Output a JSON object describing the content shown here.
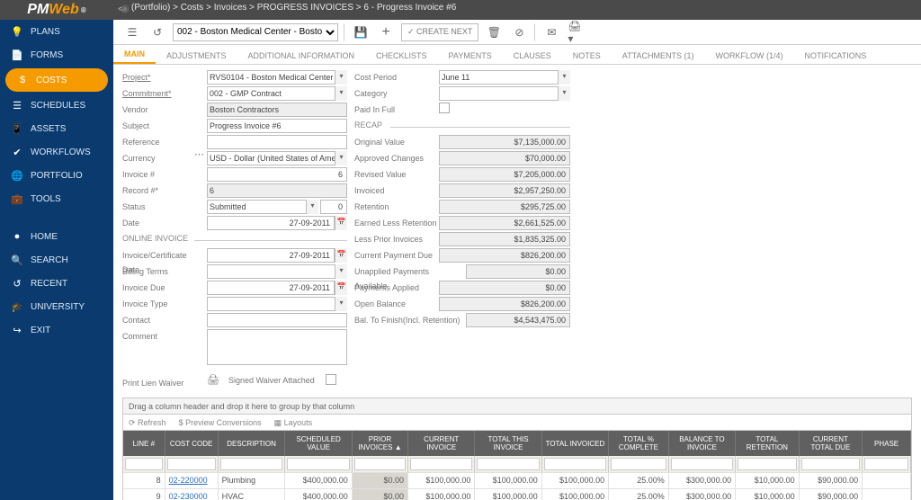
{
  "breadcrumb": "(Portfolio) > Costs > Invoices > PROGRESS INVOICES > 6 - Progress Invoice #6",
  "toolbar": {
    "project_selector": "002 - Boston Medical Center - Bosto",
    "create_next": "✓ CREATE NEXT"
  },
  "tabs": [
    "MAIN",
    "ADJUSTMENTS",
    "ADDITIONAL INFORMATION",
    "CHECKLISTS",
    "PAYMENTS",
    "CLAUSES",
    "NOTES",
    "ATTACHMENTS (1)",
    "WORKFLOW (1/4)",
    "NOTIFICATIONS"
  ],
  "leftnav": [
    {
      "ico": "💡",
      "lbl": "PLANS"
    },
    {
      "ico": "📄",
      "lbl": "FORMS"
    },
    {
      "ico": "$",
      "lbl": "COSTS",
      "active": true
    },
    {
      "ico": "☰",
      "lbl": "SCHEDULES"
    },
    {
      "ico": "📱",
      "lbl": "ASSETS"
    },
    {
      "ico": "✔",
      "lbl": "WORKFLOWS"
    },
    {
      "ico": "🌐",
      "lbl": "PORTFOLIO"
    },
    {
      "ico": "💼",
      "lbl": "TOOLS"
    },
    {
      "ico": "●",
      "lbl": "HOME"
    },
    {
      "ico": "🔍",
      "lbl": "SEARCH"
    },
    {
      "ico": "↺",
      "lbl": "RECENT"
    },
    {
      "ico": "🎓",
      "lbl": "UNIVERSITY"
    },
    {
      "ico": "↪",
      "lbl": "EXIT"
    }
  ],
  "labels": {
    "project": "Project*",
    "commitment": "Commitment*",
    "vendor": "Vendor",
    "subject": "Subject",
    "reference": "Reference",
    "currency": "Currency",
    "invoice_no": "Invoice #",
    "record_no": "Record #*",
    "status": "Status",
    "date": "Date",
    "online_invoice": "ONLINE INVOICE",
    "inv_cert_date": "Invoice/Certificate Date",
    "billing_terms": "Billing Terms",
    "invoice_due": "Invoice Due",
    "invoice_type": "Invoice Type",
    "contact": "Contact",
    "comment": "Comment",
    "print_lien": "Print Lien Waiver",
    "signed_waiver": "Signed Waiver Attached",
    "cost_period": "Cost Period",
    "category": "Category",
    "paid_full": "Paid In Full",
    "recap": "RECAP",
    "orig_val": "Original Value",
    "appr_chg": "Approved Changes",
    "rev_val": "Revised Value",
    "invoiced": "Invoiced",
    "retention": "Retention",
    "earned_less": "Earned Less Retention",
    "less_prior": "Less Prior Invoices",
    "curr_pay_due": "Current Payment Due",
    "unapp_pay": "Unapplied Payments Available",
    "pay_applied": "Payments Applied",
    "open_bal": "Open Balance",
    "bal_finish": "Bal. To Finish(Incl. Retention)"
  },
  "fields": {
    "project": "RVS0104 - Boston Medical Center",
    "commitment": "002 - GMP Contract",
    "vendor": "Boston Contractors",
    "subject": "Progress Invoice #6",
    "reference": "",
    "currency": "USD - Dollar (United States of America)",
    "invoice_no": "6",
    "record_no": "6",
    "status": "Submitted",
    "status_rev": "0",
    "date": "27-09-2011",
    "inv_cert_date": "27-09-2011",
    "billing_terms": "",
    "invoice_due": "27-09-2011",
    "invoice_type": "",
    "contact": "",
    "comment": "",
    "cost_period": "June 11",
    "category": ""
  },
  "recap": {
    "orig_val": "$7,135,000.00",
    "appr_chg": "$70,000.00",
    "rev_val": "$7,205,000.00",
    "invoiced": "$2,957,250.00",
    "retention": "$295,725.00",
    "earned_less": "$2,661,525.00",
    "less_prior": "$1,835,325.00",
    "curr_pay_due": "$826,200.00",
    "unapp_pay": "$0.00",
    "pay_applied": "$0.00",
    "open_bal": "$826,200.00",
    "bal_finish": "$4,543,475.00"
  },
  "grid": {
    "drag_hint": "Drag a column header and drop it here to group by that column",
    "tools": {
      "refresh": "⟳ Refresh",
      "preview": "$ Preview Conversions",
      "layouts": "▦ Layouts"
    },
    "headers": [
      "LINE #",
      "COST CODE",
      "DESCRIPTION",
      "SCHEDULED VALUE",
      "PRIOR INVOICES ▲",
      "CURRENT INVOICE",
      "TOTAL THIS INVOICE",
      "TOTAL INVOICED",
      "TOTAL % COMPLETE",
      "BALANCE TO INVOICE",
      "TOTAL RETENTION",
      "CURRENT TOTAL DUE",
      "PHASE"
    ],
    "rows": [
      {
        "line": "8",
        "cost": "02-220000",
        "desc": "Plumbing",
        "sched": "$400,000.00",
        "prior": "$0.00",
        "curr": "$100,000.00",
        "totthis": "$100,000.00",
        "totinv": "$100,000.00",
        "pct": "25.00%",
        "bal": "$300,000.00",
        "ret": "$10,000.00",
        "due": "$90,000.00"
      },
      {
        "line": "9",
        "cost": "02-230000",
        "desc": "HVAC",
        "sched": "$400,000.00",
        "prior": "$0.00",
        "curr": "$100,000.00",
        "totthis": "$100,000.00",
        "totinv": "$100,000.00",
        "pct": "25.00%",
        "bal": "$300,000.00",
        "ret": "$10,000.00",
        "due": "$90,000.00"
      }
    ]
  }
}
